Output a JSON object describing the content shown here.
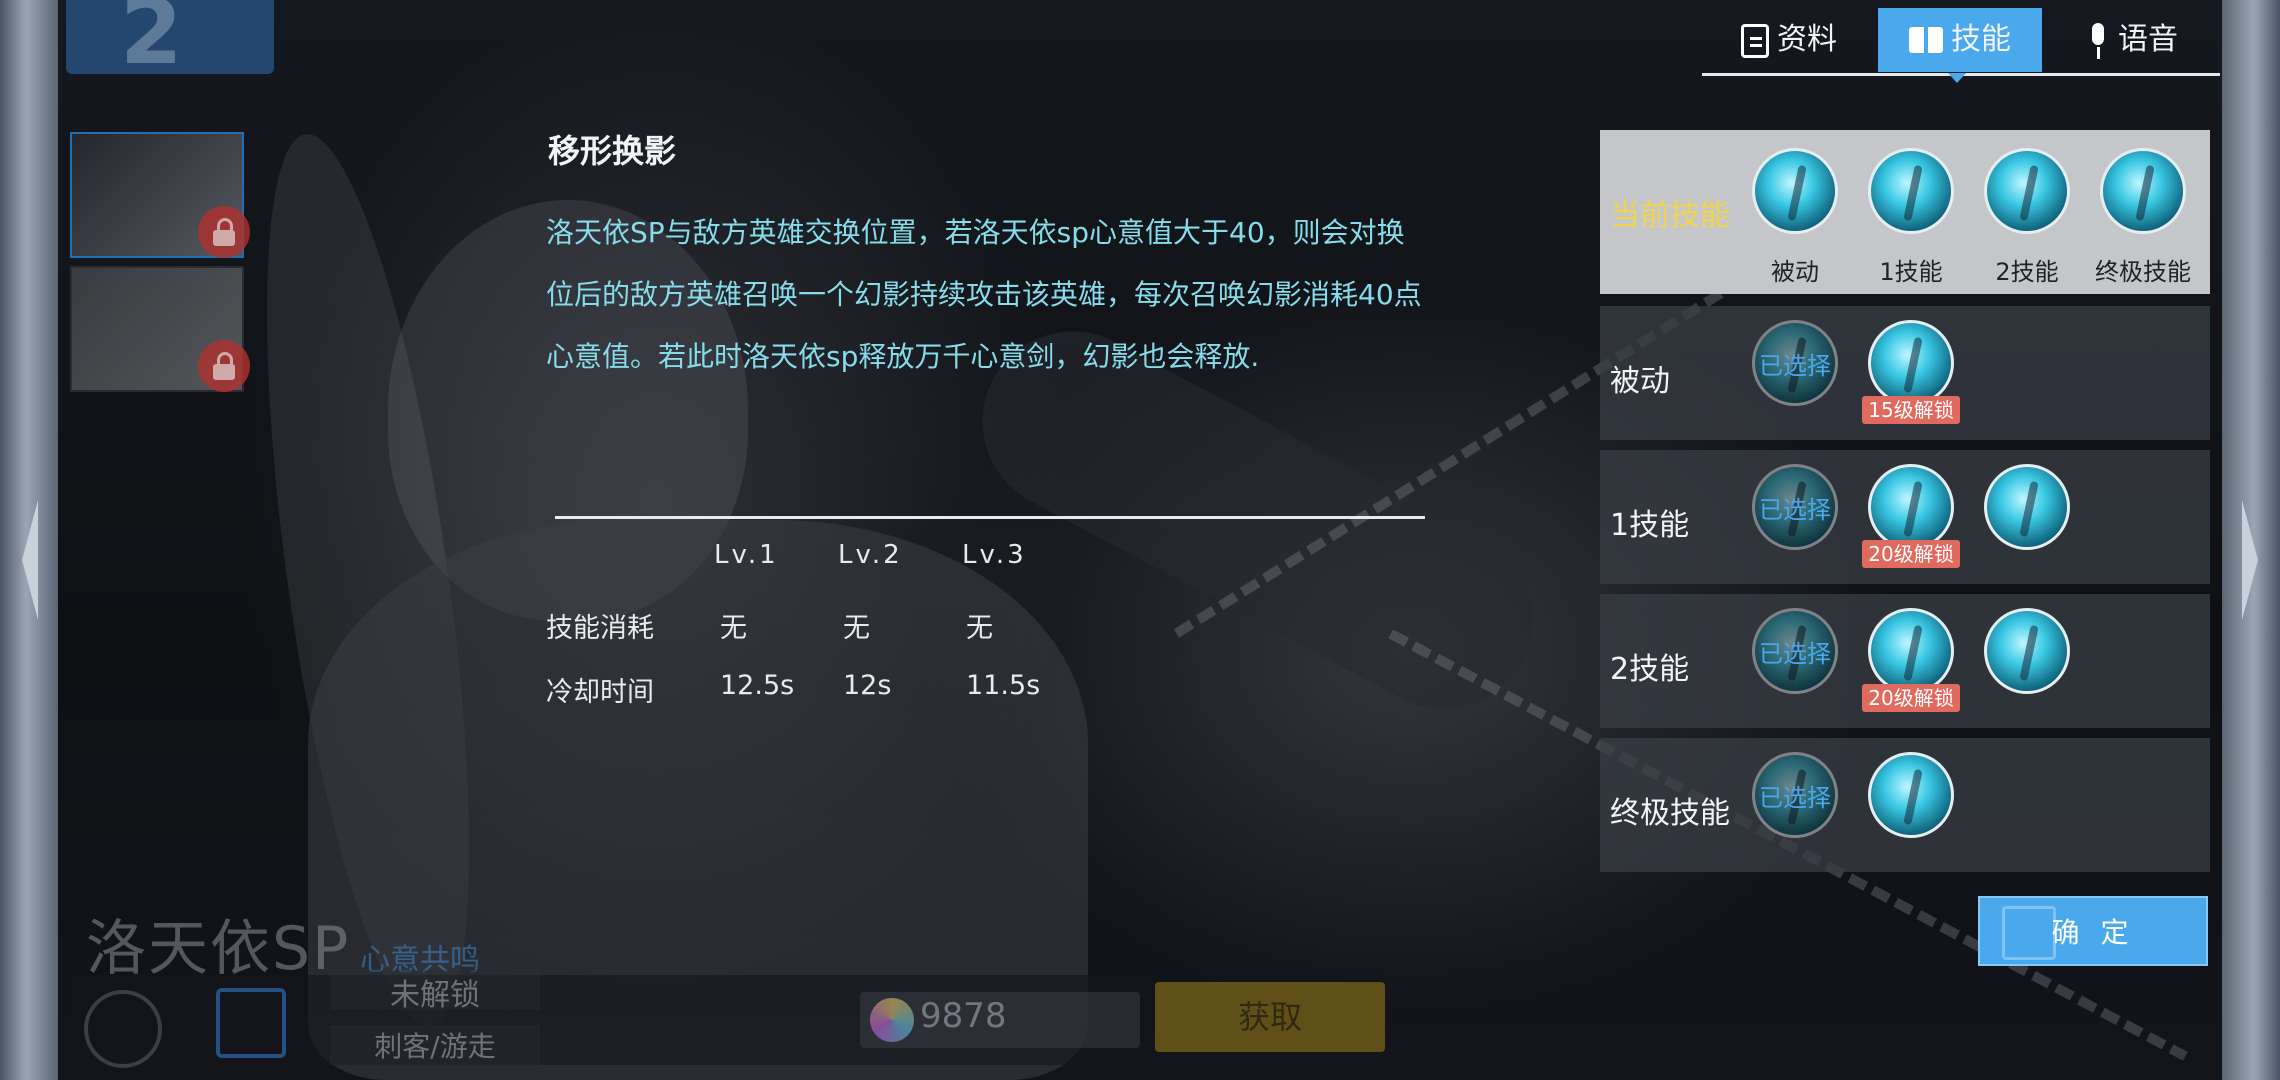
{
  "rank": "2",
  "hero": {
    "name": "洛天依SP",
    "subtitle": "心意共鸣",
    "status": "未解锁",
    "role": "刺客/游走",
    "price": "9878",
    "get_button": "获取"
  },
  "tabs": [
    {
      "label": "资料",
      "icon": "clipboard-icon",
      "active": false
    },
    {
      "label": "技能",
      "icon": "book-icon",
      "active": true
    },
    {
      "label": "语音",
      "icon": "microphone-icon",
      "active": false
    }
  ],
  "skill": {
    "title": "移形换影",
    "description": "洛天依SP与敌方英雄交换位置，若洛天依sp心意值大于40，则会对换位后的敌方英雄召唤一个幻影持续攻击该英雄，每次召唤幻影消耗40点心意值。若此时洛天依sp释放万千心意剑，幻影也会释放.",
    "levels": [
      "Lv.1",
      "Lv.2",
      "Lv.3"
    ],
    "rows": [
      {
        "label": "技能消耗",
        "values": [
          "无",
          "无",
          "无"
        ]
      },
      {
        "label": "冷却时间",
        "values": [
          "12.5s",
          "12s",
          "11.5s"
        ]
      }
    ]
  },
  "current_skills": {
    "label": "当前技能",
    "items": [
      "被动",
      "1技能",
      "2技能",
      "终极技能"
    ]
  },
  "skill_rows": [
    {
      "label": "被动",
      "selected_text": "已选择",
      "unlock": "15级解锁",
      "extra": false
    },
    {
      "label": "1技能",
      "selected_text": "已选择",
      "unlock": "20级解锁",
      "extra": true
    },
    {
      "label": "2技能",
      "selected_text": "已选择",
      "unlock": "20级解锁",
      "extra": true
    },
    {
      "label": "终极技能",
      "selected_text": "已选择",
      "unlock": "",
      "extra": false
    }
  ],
  "confirm_label": "确 定",
  "colors": {
    "accent": "#4aa8ec",
    "skill_text": "#86dcea",
    "current_label": "#f0d44a",
    "unlock_badge": "#e06a5e"
  }
}
